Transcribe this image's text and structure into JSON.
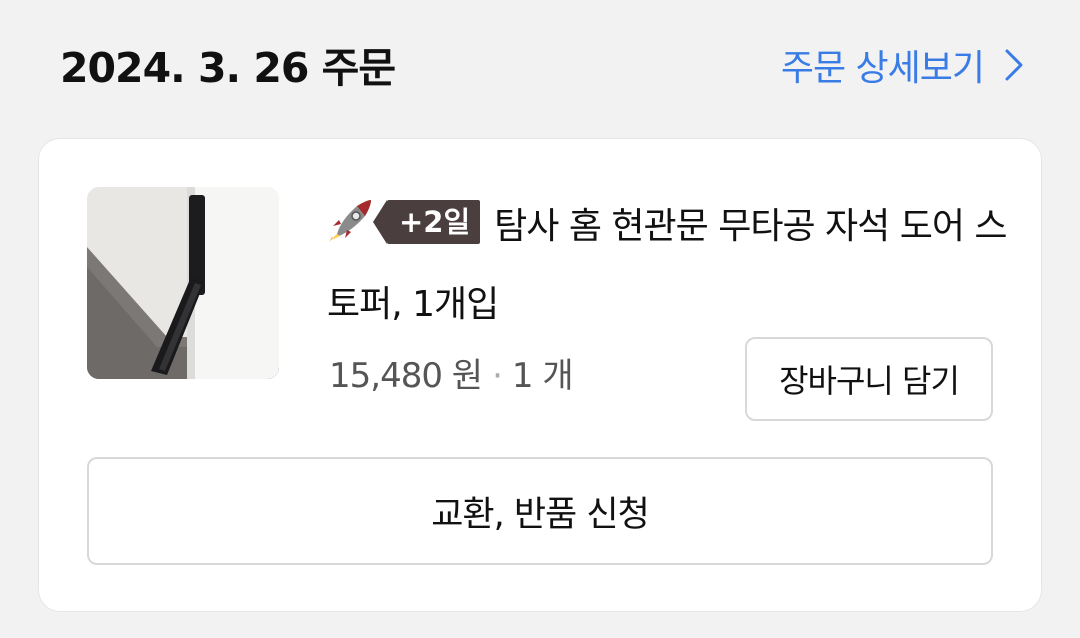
{
  "order": {
    "date_title": "2024. 3. 26 주문",
    "detail_link_label": "주문 상세보기"
  },
  "item": {
    "delivery_badge": "+2일",
    "badge_icon": "rocket-icon",
    "name": "탐사 홈 현관문 무타공 자석 도어 스토퍼, 1개입",
    "price": "15,480 원",
    "separator": "·",
    "quantity": "1 개",
    "cart_button_label": "장바구니 담기"
  },
  "actions": {
    "exchange_return_label": "교환, 반품 신청"
  },
  "colors": {
    "background": "#f2f2f3",
    "link_blue": "#3a7ce6",
    "badge_bg": "#4a3e3e",
    "border": "#d8d8da"
  }
}
